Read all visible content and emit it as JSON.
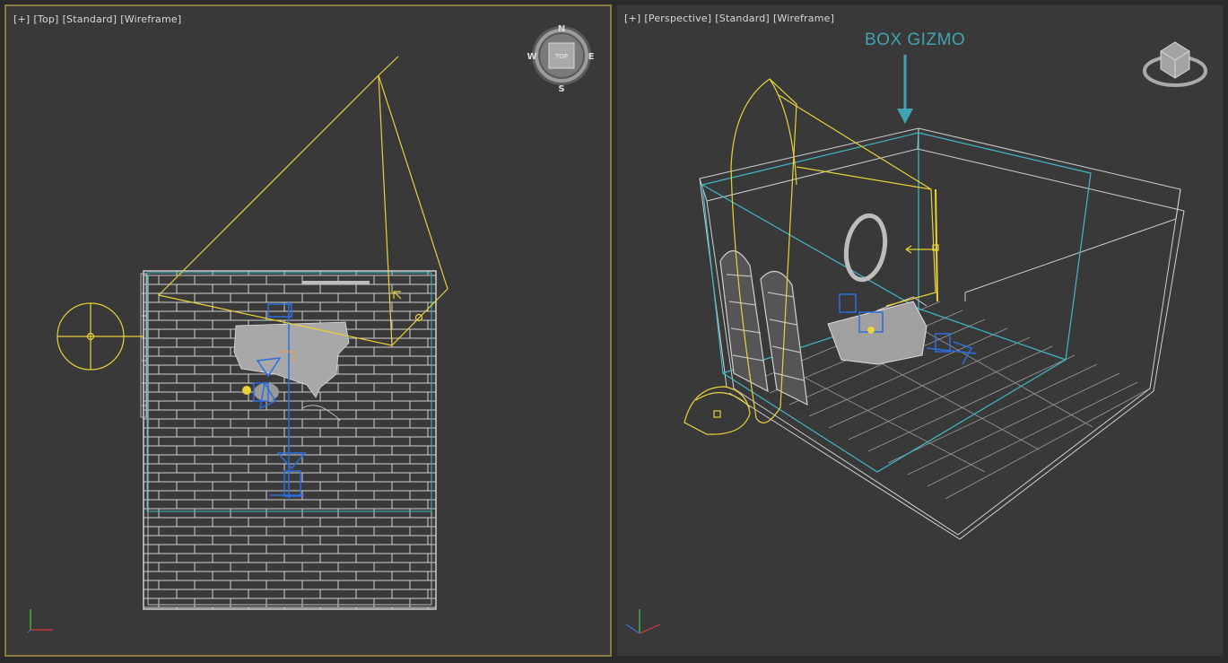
{
  "viewports": {
    "left": {
      "plus": "[+]",
      "view": "[Top]",
      "shading_mode": "[Standard]",
      "display_mode": "[Wireframe]"
    },
    "right": {
      "plus": "[+]",
      "view": "[Perspective]",
      "shading_mode": "[Standard]",
      "display_mode": "[Wireframe]"
    }
  },
  "annotation": {
    "box_gizmo_label": "BOX GIZMO"
  },
  "viewcube": {
    "face_label": "TOP",
    "compass": {
      "n": "N",
      "s": "S",
      "e": "E",
      "w": "W"
    }
  },
  "colors": {
    "viewport_bg": "#393939",
    "active_border": "#8c7a3e",
    "light_yellow": "#e8d23a",
    "gizmo_cyan": "#3fb8c8",
    "geometry_white": "#c8c8c8",
    "selection_blue": "#2a6fe0"
  },
  "icons": [
    "viewcube-icon",
    "axis-tripod-icon",
    "box-gizmo-arrow-icon"
  ]
}
